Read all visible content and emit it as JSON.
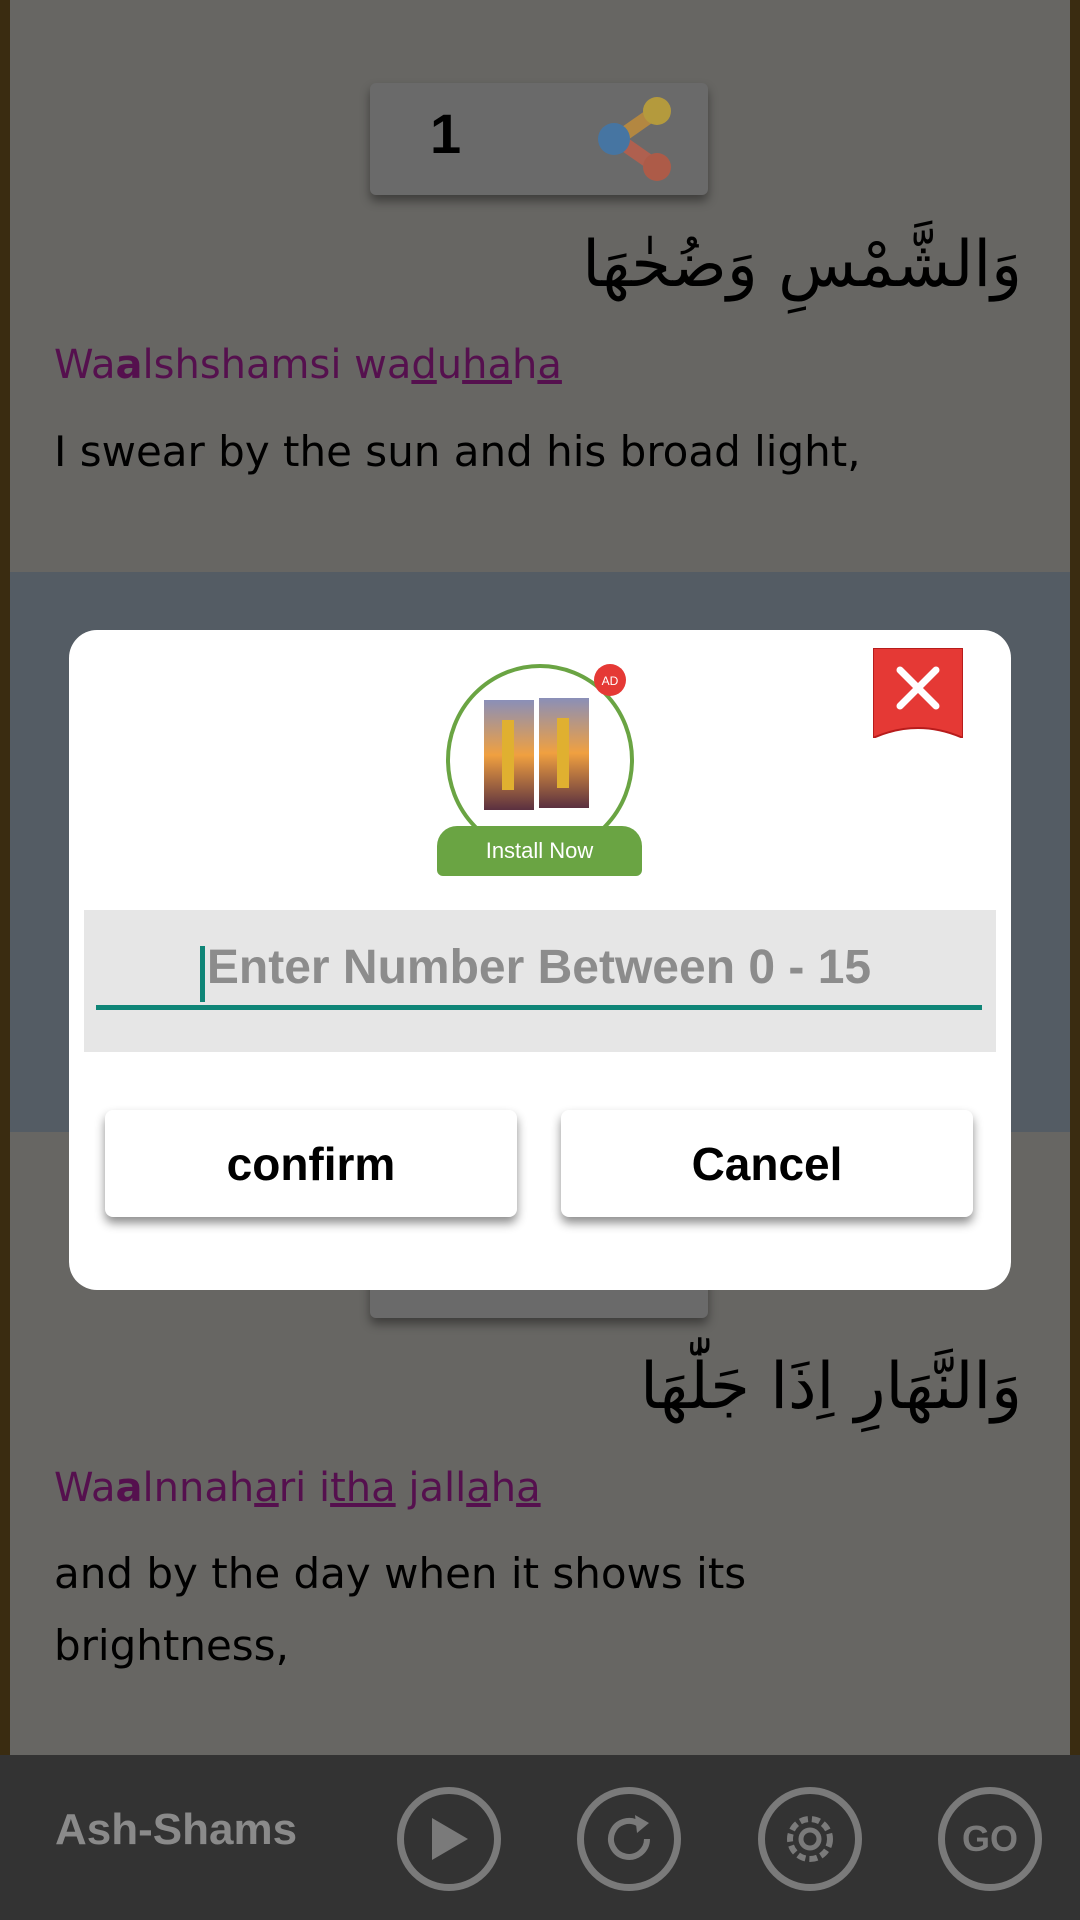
{
  "verses": [
    {
      "number": "1",
      "arabic": "وَالشَّمْسِ وَضُحٰهَا",
      "translit": [
        {
          "t": "Wa"
        },
        {
          "t": "a",
          "b": 1
        },
        {
          "t": "lshshamsi wa"
        },
        {
          "t": "d",
          "u": 1
        },
        {
          "t": "u"
        },
        {
          "t": "ha",
          "u": 1
        },
        {
          "t": "h"
        },
        {
          "t": "a",
          "u": 1
        }
      ],
      "english": "I swear by the sun and his broad light,"
    },
    {
      "arabic": "وَالنَّهَارِ اِذَا جَلّٰهَا",
      "translit": [
        {
          "t": "Wa"
        },
        {
          "t": "a",
          "b": 1
        },
        {
          "t": "lnnah"
        },
        {
          "t": "a",
          "u": 1
        },
        {
          "t": "ri i"
        },
        {
          "t": "tha",
          "u": 1
        },
        {
          "t": " jall"
        },
        {
          "t": "a",
          "u": 1
        },
        {
          "t": "h"
        },
        {
          "t": "a",
          "u": 1
        }
      ],
      "english": "and by the day when it shows its brightness,"
    }
  ],
  "dialog": {
    "ad": {
      "badge": "AD",
      "install_label": "Install Now"
    },
    "input_placeholder": "Enter Number Between 0 - 15",
    "confirm_label": "confirm",
    "cancel_label": "Cancel"
  },
  "bottom_bar": {
    "surah": "Ash-Shams",
    "icons": [
      "play-icon",
      "repeat-icon",
      "settings-icon",
      "go-icon"
    ]
  },
  "colors": {
    "accent": "#0f8577",
    "install": "#6aa443",
    "close": "#e53935",
    "translit": "#7a1a72"
  }
}
